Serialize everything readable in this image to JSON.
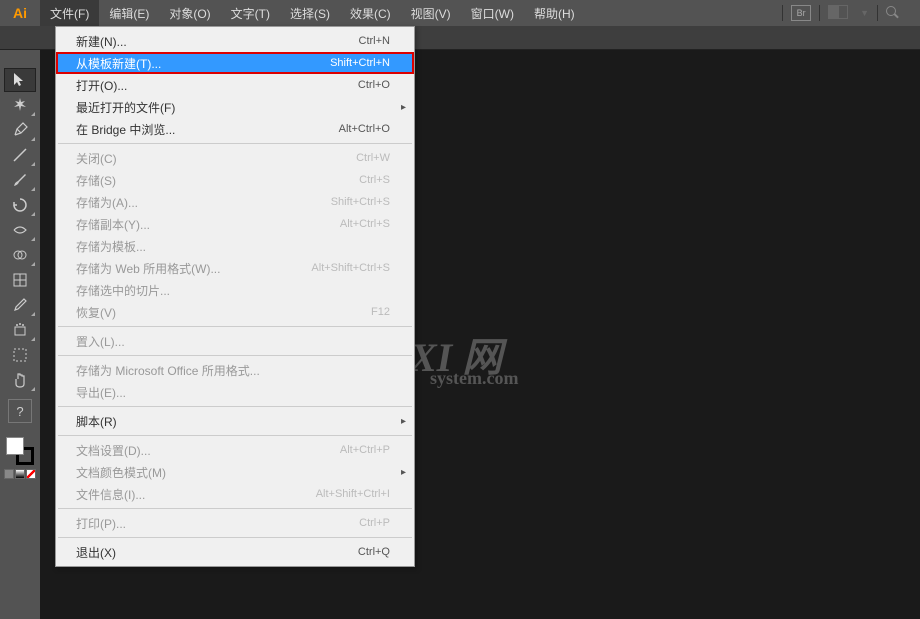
{
  "app": {
    "logo": "Ai"
  },
  "menubar": {
    "items": [
      "文件(F)",
      "编辑(E)",
      "对象(O)",
      "文字(T)",
      "选择(S)",
      "效果(C)",
      "视图(V)",
      "窗口(W)",
      "帮助(H)"
    ],
    "br_label": "Br"
  },
  "dropdown": {
    "groups": [
      [
        {
          "label": "新建(N)...",
          "shortcut": "Ctrl+N"
        },
        {
          "label": "从模板新建(T)...",
          "shortcut": "Shift+Ctrl+N",
          "highlighted": true
        },
        {
          "label": "打开(O)...",
          "shortcut": "Ctrl+O"
        },
        {
          "label": "最近打开的文件(F)",
          "submenu": true
        },
        {
          "label": "在 Bridge 中浏览...",
          "shortcut": "Alt+Ctrl+O"
        }
      ],
      [
        {
          "label": "关闭(C)",
          "shortcut": "Ctrl+W",
          "disabled": true
        },
        {
          "label": "存储(S)",
          "shortcut": "Ctrl+S",
          "disabled": true
        },
        {
          "label": "存储为(A)...",
          "shortcut": "Shift+Ctrl+S",
          "disabled": true
        },
        {
          "label": "存储副本(Y)...",
          "shortcut": "Alt+Ctrl+S",
          "disabled": true
        },
        {
          "label": "存储为模板...",
          "disabled": true
        },
        {
          "label": "存储为 Web 所用格式(W)...",
          "shortcut": "Alt+Shift+Ctrl+S",
          "disabled": true
        },
        {
          "label": "存储选中的切片...",
          "disabled": true
        },
        {
          "label": "恢复(V)",
          "shortcut": "F12",
          "disabled": true
        }
      ],
      [
        {
          "label": "置入(L)...",
          "disabled": true
        }
      ],
      [
        {
          "label": "存储为 Microsoft Office 所用格式...",
          "disabled": true
        },
        {
          "label": "导出(E)...",
          "disabled": true
        }
      ],
      [
        {
          "label": "脚本(R)",
          "submenu": true
        }
      ],
      [
        {
          "label": "文档设置(D)...",
          "shortcut": "Alt+Ctrl+P",
          "disabled": true
        },
        {
          "label": "文档颜色模式(M)",
          "submenu": true,
          "disabled": true
        },
        {
          "label": "文件信息(I)...",
          "shortcut": "Alt+Shift+Ctrl+I",
          "disabled": true
        }
      ],
      [
        {
          "label": "打印(P)...",
          "shortcut": "Ctrl+P",
          "disabled": true
        }
      ],
      [
        {
          "label": "退出(X)",
          "shortcut": "Ctrl+Q"
        }
      ]
    ]
  },
  "watermark": {
    "main": "XI 网",
    "sub": "system.com"
  },
  "toolbar": {
    "question": "?"
  }
}
